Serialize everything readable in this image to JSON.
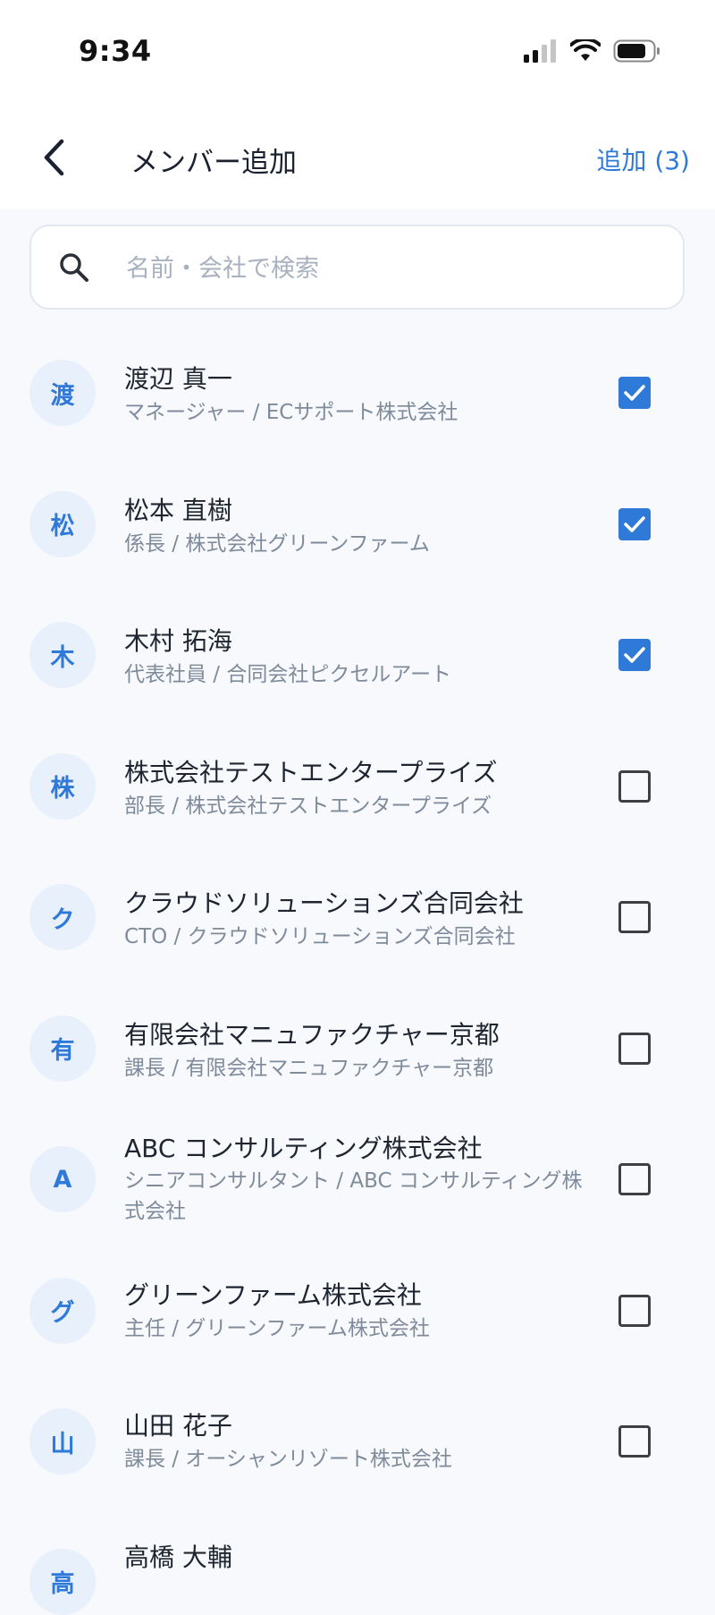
{
  "status_bar": {
    "time": "9:34"
  },
  "header": {
    "title": "メンバー追加",
    "add_label": "追加 (3)"
  },
  "search": {
    "placeholder": "名前・会社で検索",
    "value": ""
  },
  "colors": {
    "accent": "#2f7ad8",
    "avatar_bg": "#e8f0fc",
    "background": "#f7f9fc",
    "subtext": "#7f8b9b"
  },
  "members": [
    {
      "initial": "渡",
      "name": "渡辺 真一",
      "subtitle": "マネージャー / ECサポート株式会社",
      "checked": true
    },
    {
      "initial": "松",
      "name": "松本 直樹",
      "subtitle": "係長 / 株式会社グリーンファーム",
      "checked": true
    },
    {
      "initial": "木",
      "name": "木村 拓海",
      "subtitle": "代表社員 / 合同会社ピクセルアート",
      "checked": true
    },
    {
      "initial": "株",
      "name": "株式会社テストエンタープライズ",
      "subtitle": "部長 / 株式会社テストエンタープライズ",
      "checked": false
    },
    {
      "initial": "ク",
      "name": "クラウドソリューションズ合同会社",
      "subtitle": "CTO / クラウドソリューションズ合同会社",
      "checked": false
    },
    {
      "initial": "有",
      "name": "有限会社マニュファクチャー京都",
      "subtitle": "課長 / 有限会社マニュファクチャー京都",
      "checked": false
    },
    {
      "initial": "A",
      "name": "ABC コンサルティング株式会社",
      "subtitle": "シニアコンサルタント / ABC コンサルティング株式会社",
      "checked": false
    },
    {
      "initial": "グ",
      "name": "グリーンファーム株式会社",
      "subtitle": "主任 / グリーンファーム株式会社",
      "checked": false
    },
    {
      "initial": "山",
      "name": "山田 花子",
      "subtitle": "課長 / オーシャンリゾート株式会社",
      "checked": false
    },
    {
      "initial": "高",
      "name": "高橋 大輔",
      "subtitle": "",
      "checked": false
    }
  ]
}
